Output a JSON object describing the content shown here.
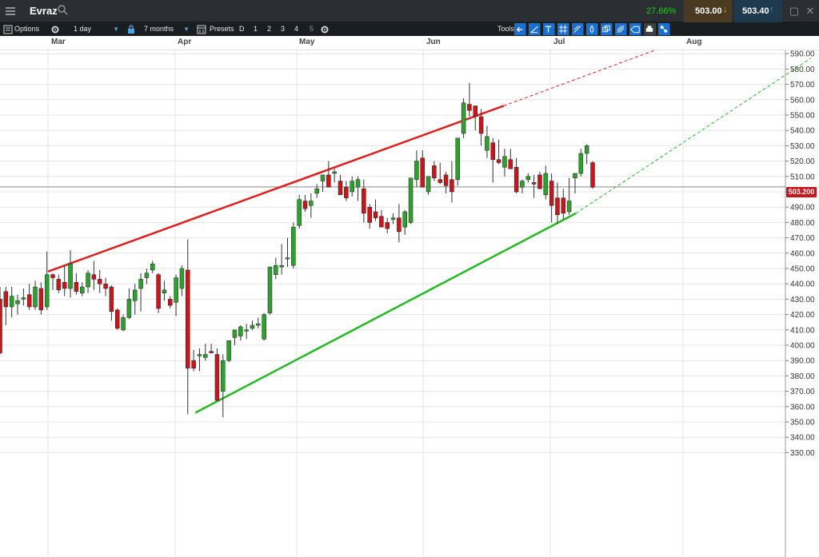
{
  "header": {
    "title": "Evraz",
    "change_pct": "27.66%",
    "sell_price": "503.00",
    "buy_price": "503.40",
    "icons": [
      "menu-icon",
      "search-icon",
      "arrow-down-icon",
      "arrow-up-icon",
      "maximize-icon",
      "close-icon"
    ]
  },
  "toolbar": {
    "options_label": "Options",
    "interval_label": "1 day",
    "range_label": "7 months",
    "presets_label": "Presets",
    "presets": [
      "D",
      "1",
      "2",
      "3",
      "4",
      "5"
    ],
    "tools_label": "Tools"
  },
  "colors": {
    "up": "#2ea02e",
    "down": "#c8161d",
    "resistance": "#e0201c",
    "support": "#22bb22",
    "current_price_tag": "#c8161d",
    "topbar": "#2b2f33",
    "toolbar": "#1b1e21",
    "tools_active": "#1a6fd1"
  },
  "chart_data": {
    "type": "candlestick",
    "instrument": "Evraz",
    "interval": "1 day",
    "months": [
      "Mar",
      "Apr",
      "May",
      "Jun",
      "Jul",
      "Aug"
    ],
    "y_ticks": [
      "330.00",
      "340.00",
      "350.00",
      "360.00",
      "370.00",
      "380.00",
      "390.00",
      "400.00",
      "410.00",
      "420.00",
      "430.00",
      "440.00",
      "450.00",
      "460.00",
      "470.00",
      "480.00",
      "490.00",
      "500.00",
      "510.00",
      "520.00",
      "530.00",
      "540.00",
      "550.00",
      "560.00",
      "570.00",
      "580.00",
      "590.00"
    ],
    "ylim": [
      327,
      592
    ],
    "current_price": 503.2,
    "current_price_label": "503.200",
    "candles": [
      {
        "o": 430,
        "h": 438,
        "l": 394,
        "c": 395
      },
      {
        "o": 435,
        "h": 438,
        "l": 413,
        "c": 425
      },
      {
        "o": 425,
        "h": 438,
        "l": 418,
        "c": 432
      },
      {
        "o": 427,
        "h": 433,
        "l": 420,
        "c": 429
      },
      {
        "o": 430,
        "h": 437,
        "l": 426,
        "c": 431
      },
      {
        "o": 433,
        "h": 440,
        "l": 423,
        "c": 425
      },
      {
        "o": 425,
        "h": 442,
        "l": 423,
        "c": 438
      },
      {
        "o": 437,
        "h": 441,
        "l": 420,
        "c": 423
      },
      {
        "o": 425,
        "h": 461,
        "l": 423,
        "c": 446
      },
      {
        "o": 446,
        "h": 447,
        "l": 436,
        "c": 444
      },
      {
        "o": 443,
        "h": 446,
        "l": 434,
        "c": 436
      },
      {
        "o": 441,
        "h": 452,
        "l": 432,
        "c": 437
      },
      {
        "o": 437,
        "h": 462,
        "l": 431,
        "c": 453
      },
      {
        "o": 441,
        "h": 447,
        "l": 433,
        "c": 435
      },
      {
        "o": 434,
        "h": 441,
        "l": 432,
        "c": 438
      },
      {
        "o": 438,
        "h": 449,
        "l": 434,
        "c": 447
      },
      {
        "o": 446,
        "h": 455,
        "l": 436,
        "c": 443
      },
      {
        "o": 443,
        "h": 449,
        "l": 434,
        "c": 440
      },
      {
        "o": 440,
        "h": 444,
        "l": 432,
        "c": 437
      },
      {
        "o": 438,
        "h": 439,
        "l": 416,
        "c": 422
      },
      {
        "o": 423,
        "h": 424,
        "l": 410,
        "c": 411
      },
      {
        "o": 410,
        "h": 420,
        "l": 409,
        "c": 418
      },
      {
        "o": 418,
        "h": 437,
        "l": 417,
        "c": 430
      },
      {
        "o": 429,
        "h": 440,
        "l": 420,
        "c": 436
      },
      {
        "o": 437,
        "h": 447,
        "l": 422,
        "c": 443
      },
      {
        "o": 444,
        "h": 450,
        "l": 440,
        "c": 447
      },
      {
        "o": 449,
        "h": 455,
        "l": 447,
        "c": 453
      },
      {
        "o": 446,
        "h": 447,
        "l": 421,
        "c": 424
      },
      {
        "o": 434,
        "h": 442,
        "l": 429,
        "c": 436
      },
      {
        "o": 430,
        "h": 432,
        "l": 424,
        "c": 426
      },
      {
        "o": 428,
        "h": 446,
        "l": 419,
        "c": 444
      },
      {
        "o": 437,
        "h": 452,
        "l": 432,
        "c": 450
      },
      {
        "o": 449,
        "h": 469,
        "l": 355,
        "c": 385
      },
      {
        "o": 390,
        "h": 397,
        "l": 383,
        "c": 385
      },
      {
        "o": 393,
        "h": 398,
        "l": 383,
        "c": 394
      },
      {
        "o": 392,
        "h": 401,
        "l": 390,
        "c": 394
      },
      {
        "o": 396,
        "h": 401,
        "l": 395,
        "c": 395
      },
      {
        "o": 394,
        "h": 398,
        "l": 365,
        "c": 364
      },
      {
        "o": 370,
        "h": 394,
        "l": 353,
        "c": 390
      },
      {
        "o": 390,
        "h": 403,
        "l": 389,
        "c": 403
      },
      {
        "o": 405,
        "h": 410,
        "l": 400,
        "c": 410
      },
      {
        "o": 406,
        "h": 413,
        "l": 403,
        "c": 412
      },
      {
        "o": 410,
        "h": 414,
        "l": 404,
        "c": 410
      },
      {
        "o": 411,
        "h": 416,
        "l": 410,
        "c": 413
      },
      {
        "o": 413,
        "h": 418,
        "l": 411,
        "c": 414
      },
      {
        "o": 404,
        "h": 421,
        "l": 403,
        "c": 420
      },
      {
        "o": 421,
        "h": 451,
        "l": 420,
        "c": 451
      },
      {
        "o": 446,
        "h": 457,
        "l": 443,
        "c": 452
      },
      {
        "o": 451,
        "h": 466,
        "l": 446,
        "c": 452
      },
      {
        "o": 457,
        "h": 470,
        "l": 451,
        "c": 457
      },
      {
        "o": 452,
        "h": 480,
        "l": 450,
        "c": 477
      },
      {
        "o": 478,
        "h": 498,
        "l": 476,
        "c": 495
      },
      {
        "o": 494,
        "h": 498,
        "l": 487,
        "c": 489
      },
      {
        "o": 491,
        "h": 499,
        "l": 483,
        "c": 494
      },
      {
        "o": 499,
        "h": 505,
        "l": 496,
        "c": 502
      },
      {
        "o": 507,
        "h": 511,
        "l": 500,
        "c": 511
      },
      {
        "o": 511,
        "h": 520,
        "l": 505,
        "c": 503
      },
      {
        "o": 512,
        "h": 515,
        "l": 506,
        "c": 513
      },
      {
        "o": 507,
        "h": 511,
        "l": 499,
        "c": 498
      },
      {
        "o": 503,
        "h": 507,
        "l": 494,
        "c": 496
      },
      {
        "o": 500,
        "h": 510,
        "l": 497,
        "c": 507
      },
      {
        "o": 503,
        "h": 510,
        "l": 494,
        "c": 508
      },
      {
        "o": 502,
        "h": 508,
        "l": 480,
        "c": 486
      },
      {
        "o": 490,
        "h": 492,
        "l": 476,
        "c": 480
      },
      {
        "o": 487,
        "h": 495,
        "l": 481,
        "c": 483
      },
      {
        "o": 484,
        "h": 488,
        "l": 480,
        "c": 477
      },
      {
        "o": 480,
        "h": 483,
        "l": 473,
        "c": 476
      },
      {
        "o": 482,
        "h": 486,
        "l": 479,
        "c": 483
      },
      {
        "o": 483,
        "h": 492,
        "l": 467,
        "c": 474
      },
      {
        "o": 477,
        "h": 488,
        "l": 472,
        "c": 487
      },
      {
        "o": 480,
        "h": 501,
        "l": 479,
        "c": 509
      },
      {
        "o": 508,
        "h": 527,
        "l": 503,
        "c": 520
      },
      {
        "o": 522,
        "h": 527,
        "l": 503,
        "c": 503
      },
      {
        "o": 500,
        "h": 510,
        "l": 498,
        "c": 510
      },
      {
        "o": 517,
        "h": 520,
        "l": 507,
        "c": 509
      },
      {
        "o": 508,
        "h": 519,
        "l": 505,
        "c": 506
      },
      {
        "o": 511,
        "h": 513,
        "l": 499,
        "c": 504
      },
      {
        "o": 508,
        "h": 520,
        "l": 493,
        "c": 500
      },
      {
        "o": 508,
        "h": 530,
        "l": 504,
        "c": 535
      },
      {
        "o": 538,
        "h": 561,
        "l": 535,
        "c": 558
      },
      {
        "o": 557,
        "h": 571,
        "l": 549,
        "c": 553
      },
      {
        "o": 556,
        "h": 556,
        "l": 540,
        "c": 549
      },
      {
        "o": 549,
        "h": 554,
        "l": 530,
        "c": 538
      },
      {
        "o": 527,
        "h": 543,
        "l": 522,
        "c": 536
      },
      {
        "o": 532,
        "h": 535,
        "l": 506,
        "c": 521
      },
      {
        "o": 521,
        "h": 534,
        "l": 518,
        "c": 519
      },
      {
        "o": 516,
        "h": 528,
        "l": 510,
        "c": 523
      },
      {
        "o": 521,
        "h": 528,
        "l": 515,
        "c": 515
      },
      {
        "o": 516,
        "h": 522,
        "l": 499,
        "c": 500
      },
      {
        "o": 503,
        "h": 508,
        "l": 499,
        "c": 507
      },
      {
        "o": 508,
        "h": 512,
        "l": 506,
        "c": 510
      },
      {
        "o": 506,
        "h": 511,
        "l": 496,
        "c": 505
      },
      {
        "o": 511,
        "h": 513,
        "l": 502,
        "c": 502
      },
      {
        "o": 498,
        "h": 517,
        "l": 495,
        "c": 512
      },
      {
        "o": 507,
        "h": 512,
        "l": 480,
        "c": 491
      },
      {
        "o": 496,
        "h": 506,
        "l": 479,
        "c": 485
      },
      {
        "o": 496,
        "h": 502,
        "l": 482,
        "c": 486
      },
      {
        "o": 487,
        "h": 509,
        "l": 485,
        "c": 494
      },
      {
        "o": 509,
        "h": 511,
        "l": 499,
        "c": 512
      },
      {
        "o": 512,
        "h": 528,
        "l": 510,
        "c": 525
      },
      {
        "o": 525,
        "h": 531,
        "l": 518,
        "c": 530
      },
      {
        "o": 519,
        "h": 520,
        "l": 502,
        "c": 503
      }
    ],
    "trendlines": [
      {
        "name": "resistance",
        "style": "solid",
        "color": "#e0201c",
        "from": {
          "x": "Mar 1",
          "y": 448
        },
        "to": {
          "x": "Jun 20",
          "y": 556
        }
      },
      {
        "name": "resistance-extension",
        "style": "dashed",
        "color": "#e0201c",
        "from": {
          "x": "Jun 20",
          "y": 556
        },
        "to": {
          "x": "Jul 31",
          "y": 598
        }
      },
      {
        "name": "support",
        "style": "solid",
        "color": "#22bb22",
        "from": {
          "x": "Apr 6",
          "y": 356
        },
        "to": {
          "x": "Jul 7",
          "y": 486
        }
      },
      {
        "name": "support-extension",
        "style": "dashed",
        "color": "#22bb22",
        "from": {
          "x": "Jul 7",
          "y": 486
        },
        "to": {
          "x": "Aug 31",
          "y": 587
        }
      }
    ]
  }
}
